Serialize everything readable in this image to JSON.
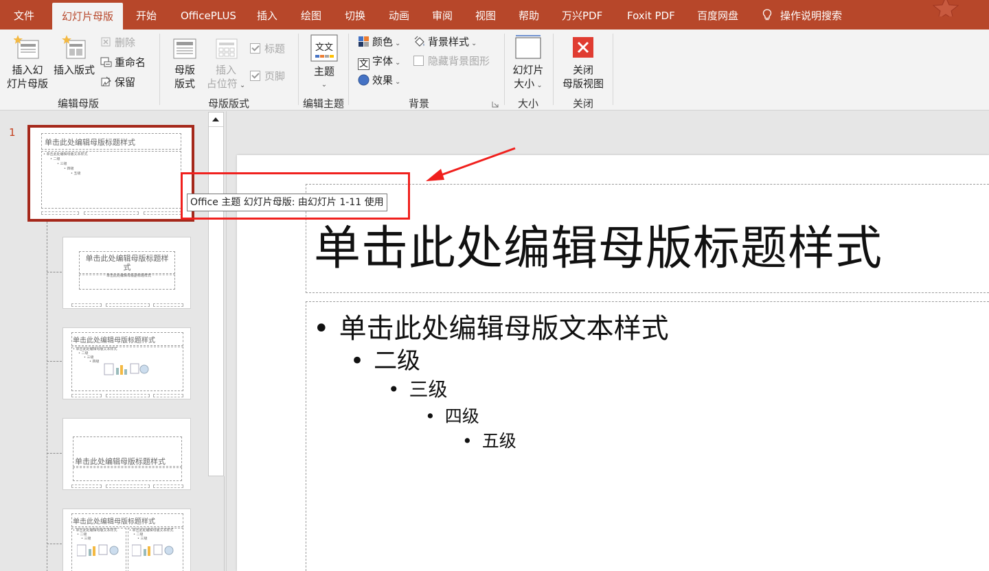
{
  "tabs": [
    {
      "label": "文件",
      "active": false
    },
    {
      "label": "幻灯片母版",
      "active": true
    },
    {
      "label": "开始",
      "active": false
    },
    {
      "label": "OfficePLUS",
      "active": false
    },
    {
      "label": "插入",
      "active": false
    },
    {
      "label": "绘图",
      "active": false
    },
    {
      "label": "切换",
      "active": false
    },
    {
      "label": "动画",
      "active": false
    },
    {
      "label": "审阅",
      "active": false
    },
    {
      "label": "视图",
      "active": false
    },
    {
      "label": "帮助",
      "active": false
    },
    {
      "label": "万兴PDF",
      "active": false
    },
    {
      "label": "Foxit PDF",
      "active": false
    },
    {
      "label": "百度网盘",
      "active": false
    }
  ],
  "tell_me": {
    "label": "操作说明搜索",
    "icon": "lightbulb-icon"
  },
  "ribbon": {
    "edit_master": {
      "label": "编辑母版",
      "insert_slide_master": {
        "line1": "插入幻",
        "line2": "灯片母版"
      },
      "insert_layout": {
        "label": "插入版式"
      },
      "delete": {
        "label": "删除",
        "enabled": false
      },
      "rename": {
        "label": "重命名"
      },
      "preserve": {
        "label": "保留"
      }
    },
    "master_layout": {
      "label": "母版版式",
      "master_layout_btn": {
        "line1": "母版",
        "line2": "版式"
      },
      "insert_placeholder": {
        "line1": "插入",
        "line2": "占位符",
        "enabled": false
      },
      "title": {
        "label": "标题",
        "checked": true,
        "enabled": false
      },
      "footers": {
        "label": "页脚",
        "checked": true,
        "enabled": false
      }
    },
    "edit_theme": {
      "label": "编辑主题",
      "themes": {
        "label": "主题",
        "icon_text": "文文"
      }
    },
    "background": {
      "label": "背景",
      "colors": {
        "label": "颜色"
      },
      "fonts": {
        "label": "字体",
        "icon_text": "文"
      },
      "effects": {
        "label": "效果"
      },
      "background_styles": {
        "label": "背景样式"
      },
      "hide_background_graphics": {
        "label": "隐藏背景图形",
        "checked": false,
        "enabled": false
      }
    },
    "size": {
      "label": "大小",
      "slide_size": {
        "line1": "幻灯片",
        "line2": "大小"
      }
    },
    "close": {
      "label": "关闭",
      "close_master_view": {
        "line1": "关闭",
        "line2": "母版视图"
      }
    }
  },
  "thumbnails": {
    "selected_number": "1",
    "master": {
      "title": "单击此处编辑母版标题样式",
      "levels": [
        "• 单击此处编辑母版文本样式",
        "• 二级",
        "• 三级",
        "• 四级",
        "• 五级"
      ]
    },
    "layout1": {
      "title": "单击此处编辑母版标题样式",
      "subtitle": "单击此处编辑母版副标题样式"
    },
    "layout2": {
      "title": "单击此处编辑母版标题样式",
      "body": [
        "• 单击此处编辑母版文本样式",
        "• 二级",
        "• 三级",
        "• 四级"
      ]
    },
    "layout3": {
      "title": "单击此处编辑母版标题样式"
    },
    "layout4": {
      "title": "单击此处编辑母版标题样式",
      "left": [
        "• 单击此处编辑母版文本样式",
        "• 二级",
        "• 三级"
      ],
      "right": [
        "• 单击此处编辑母版文本样式",
        "• 二级",
        "• 三级"
      ]
    }
  },
  "tooltip": "Office 主题 幻灯片母版: 由幻灯片 1-11 使用",
  "slide": {
    "title": "单击此处编辑母版标题样式",
    "levels": [
      {
        "text": "单击此处编辑母版文本样式"
      },
      {
        "text": "二级"
      },
      {
        "text": "三级"
      },
      {
        "text": "四级"
      },
      {
        "text": "五级"
      }
    ]
  },
  "colors": {
    "accent": "#b7472a",
    "ribbon_bg": "#f3f3f3",
    "selection_border": "#a5281b",
    "annotation": "#f0201d"
  }
}
